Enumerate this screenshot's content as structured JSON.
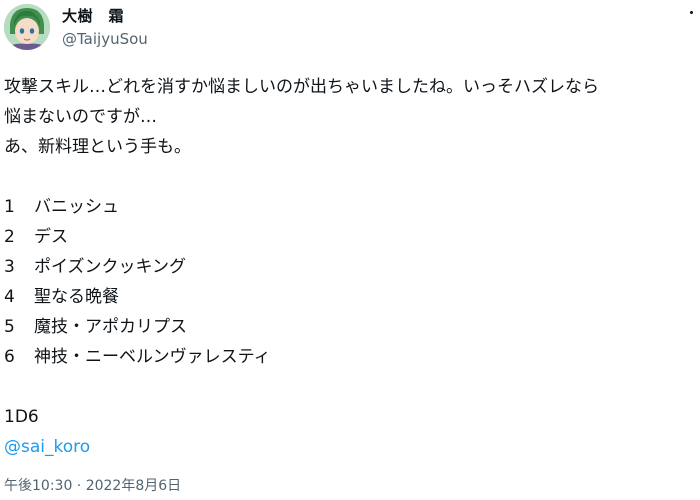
{
  "author": {
    "display_name": "大樹　霜",
    "handle": "@TaijyuSou",
    "avatar_icon": "user-avatar"
  },
  "tweet": {
    "lines": [
      "攻撃スキル…どれを消すか悩ましいのが出ちゃいましたね。いっそハズレなら",
      "悩まないのですが…",
      "あ、新料理という手も。"
    ],
    "options": [
      {
        "num": "1",
        "label": "バニッシュ"
      },
      {
        "num": "2",
        "label": "デス"
      },
      {
        "num": "3",
        "label": "ポイズンクッキング"
      },
      {
        "num": "4",
        "label": "聖なる晩餐"
      },
      {
        "num": "5",
        "label": "魔技・アポカリプス"
      },
      {
        "num": "6",
        "label": "神技・ニーベルンヴァレスティ"
      }
    ],
    "dice": "1D6",
    "mention": "@sai_koro",
    "timestamp": "午後10:30 · 2022年8月6日"
  },
  "colors": {
    "text": "#0f1419",
    "secondary": "#536471",
    "link": "#1d9bf0"
  },
  "icons": {
    "more": "more-dots-icon"
  }
}
